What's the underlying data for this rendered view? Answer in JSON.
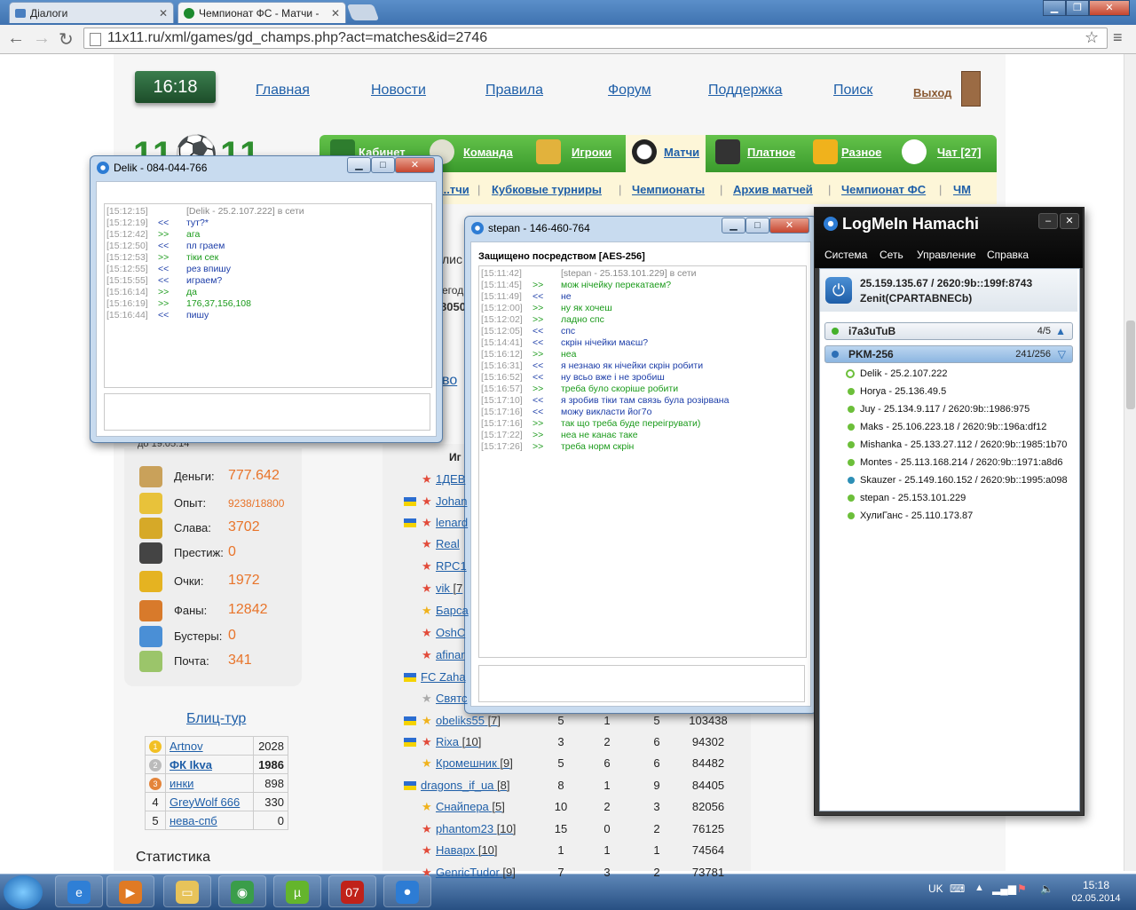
{
  "browser": {
    "tabs": [
      {
        "title": "Діалоги"
      },
      {
        "title": "Чемпионат ФС - Матчи -"
      }
    ],
    "url": "11x11.ru/xml/games/gd_champs.php?act=matches&id=2746"
  },
  "site": {
    "clock": "16:18",
    "top_links": [
      "Главная",
      "Новости",
      "Правила",
      "Форум",
      "Поддержка",
      "Поиск"
    ],
    "exit": "Выход",
    "logo": "11⚽11",
    "main_nav": [
      "Кабинет",
      "Команда",
      "Игроки",
      "Матчи",
      "Платное",
      "Разное",
      "Чат [27]"
    ],
    "sub_nav": [
      "...тчи",
      "Кубковые турниры",
      "Чемпионаты",
      "Архив матчей",
      "Чемпионат ФС",
      "ЧМ"
    ],
    "partial_date": "до 19.05.14",
    "stats": [
      {
        "label": "Деньги:",
        "value": "777.642",
        "icon": "money-bag-icon"
      },
      {
        "label": "Опыт:",
        "value": "9238/18800",
        "icon": "experience-icon"
      },
      {
        "label": "Слава:",
        "value": "3702",
        "icon": "podium-icon"
      },
      {
        "label": "Престиж:",
        "value": "0",
        "icon": "butler-icon"
      },
      {
        "label": "Очки:",
        "value": "1972",
        "icon": "trophy-icon"
      },
      {
        "label": "Фаны:",
        "value": "12842",
        "icon": "fans-icon"
      },
      {
        "label": "Бустеры:",
        "value": "0",
        "icon": "gift-icon"
      },
      {
        "label": "Почта:",
        "value": "341",
        "icon": "mail-icon"
      }
    ],
    "blitz_title": "Блиц-тур",
    "blitz": [
      {
        "rank": "1",
        "name": "Artnov",
        "score": "2028"
      },
      {
        "rank": "2",
        "name": "ФК Ikva",
        "score": "1986"
      },
      {
        "rank": "3",
        "name": "инки",
        "score": "898"
      },
      {
        "rank": "4",
        "name": "GreyWolf 666",
        "score": "330"
      },
      {
        "rank": "5",
        "name": "нева-спб",
        "score": "0"
      }
    ],
    "stats_heading": "Статистика",
    "table_header": "Иг",
    "partial_left_texts": [
      "лис",
      "егод",
      "8050",
      "во"
    ],
    "table_rows": [
      {
        "name": "1ДЕВ",
        "lvl": "",
        "flag": false,
        "star": "red",
        "a": "",
        "b": "",
        "c": "",
        "pts": ""
      },
      {
        "name": "Johan",
        "lvl": "",
        "flag": true,
        "star": "red",
        "a": "",
        "b": "",
        "c": "",
        "pts": ""
      },
      {
        "name": "lenard",
        "lvl": "",
        "flag": true,
        "star": "red",
        "a": "",
        "b": "",
        "c": "",
        "pts": ""
      },
      {
        "name": "Real",
        "lvl": "",
        "flag": false,
        "star": "red",
        "a": "",
        "b": "",
        "c": "",
        "pts": ""
      },
      {
        "name": "RPC1",
        "lvl": "",
        "flag": false,
        "star": "red",
        "a": "",
        "b": "",
        "c": "",
        "pts": ""
      },
      {
        "name": "vik",
        "lvl": "[7",
        "flag": false,
        "star": "red",
        "a": "",
        "b": "",
        "c": "",
        "pts": ""
      },
      {
        "name": "Барса",
        "lvl": "",
        "flag": false,
        "star": "gold",
        "a": "",
        "b": "",
        "c": "",
        "pts": ""
      },
      {
        "name": "OshC",
        "lvl": "",
        "flag": false,
        "star": "red",
        "a": "",
        "b": "",
        "c": "",
        "pts": ""
      },
      {
        "name": "afinar",
        "lvl": "",
        "flag": false,
        "star": "red",
        "a": "",
        "b": "",
        "c": "",
        "pts": ""
      },
      {
        "name": "FC Zaha",
        "lvl": "",
        "flag": true,
        "star": "",
        "a": "",
        "b": "",
        "c": "",
        "pts": ""
      },
      {
        "name": "Святс",
        "lvl": "",
        "flag": false,
        "star": "gray",
        "a": "",
        "b": "",
        "c": "",
        "pts": ""
      },
      {
        "name": "obeliks55",
        "lvl": "[7]",
        "flag": true,
        "star": "gold",
        "a": "5",
        "b": "1",
        "c": "5",
        "pts": "103438"
      },
      {
        "name": "Rixa",
        "lvl": "[10]",
        "flag": true,
        "star": "red",
        "a": "3",
        "b": "2",
        "c": "6",
        "pts": "94302"
      },
      {
        "name": "Кромешник",
        "lvl": "[9]",
        "flag": false,
        "star": "gold",
        "a": "5",
        "b": "6",
        "c": "6",
        "pts": "84482"
      },
      {
        "name": "dragons_if_ua",
        "lvl": "[8]",
        "flag": true,
        "star": "",
        "a": "8",
        "b": "1",
        "c": "9",
        "pts": "84405"
      },
      {
        "name": "Снайпера",
        "lvl": "[5]",
        "flag": false,
        "star": "gold",
        "a": "10",
        "b": "2",
        "c": "3",
        "pts": "82056"
      },
      {
        "name": "phantom23",
        "lvl": "[10]",
        "flag": false,
        "star": "red",
        "a": "15",
        "b": "0",
        "c": "2",
        "pts": "76125"
      },
      {
        "name": "Наварх",
        "lvl": "[10]",
        "flag": false,
        "star": "red",
        "a": "1",
        "b": "1",
        "c": "1",
        "pts": "74564"
      },
      {
        "name": "GenricTudor",
        "lvl": "[9]",
        "flag": false,
        "star": "red",
        "a": "7",
        "b": "3",
        "c": "2",
        "pts": "73781"
      }
    ]
  },
  "chat_delik": {
    "title": "Delik - 084-044-766",
    "lines": [
      {
        "ts": "[15:12:15]",
        "dir": "",
        "text": "[Delik - 25.2.107.222] в сети",
        "kind": "sys"
      },
      {
        "ts": "[15:12:19]",
        "dir": "<<",
        "text": "тут?*",
        "kind": "in"
      },
      {
        "ts": "[15:12:42]",
        "dir": ">>",
        "text": "ага",
        "kind": "out"
      },
      {
        "ts": "[15:12:50]",
        "dir": "<<",
        "text": "пл граем",
        "kind": "in"
      },
      {
        "ts": "[15:12:53]",
        "dir": ">>",
        "text": "тіки сек",
        "kind": "out"
      },
      {
        "ts": "[15:12:55]",
        "dir": "<<",
        "text": "рез впишу",
        "kind": "in"
      },
      {
        "ts": "[15:15:55]",
        "dir": "<<",
        "text": "играем?",
        "kind": "in"
      },
      {
        "ts": "[15:16:14]",
        "dir": ">>",
        "text": "да",
        "kind": "out"
      },
      {
        "ts": "[15:16:19]",
        "dir": ">>",
        "text": "176,37,156,108",
        "kind": "out"
      },
      {
        "ts": "[15:16:44]",
        "dir": "<<",
        "text": "пишу",
        "kind": "in"
      }
    ]
  },
  "chat_stepan": {
    "title": "stepan - 146-460-764",
    "secure": "Защищено посредством [AES-256]",
    "lines": [
      {
        "ts": "[15:11:42]",
        "dir": "",
        "text": "[stepan - 25.153.101.229] в сети",
        "kind": "sys"
      },
      {
        "ts": "[15:11:45]",
        "dir": ">>",
        "text": "мож нічейку перекатаем?",
        "kind": "out"
      },
      {
        "ts": "[15:11:49]",
        "dir": "<<",
        "text": "не",
        "kind": "in"
      },
      {
        "ts": "[15:12:00]",
        "dir": ">>",
        "text": "ну як хочеш",
        "kind": "out"
      },
      {
        "ts": "[15:12:02]",
        "dir": ">>",
        "text": "ладно спс",
        "kind": "out"
      },
      {
        "ts": "[15:12:05]",
        "dir": "<<",
        "text": "спс",
        "kind": "in"
      },
      {
        "ts": "[15:14:41]",
        "dir": "<<",
        "text": "скрін нічейки маєш?",
        "kind": "in"
      },
      {
        "ts": "[15:16:12]",
        "dir": ">>",
        "text": "неа",
        "kind": "out"
      },
      {
        "ts": "[15:16:31]",
        "dir": "<<",
        "text": "я незнаю  як нічейки скрін робити",
        "kind": "in"
      },
      {
        "ts": "[15:16:52]",
        "dir": "<<",
        "text": "ну всьо вже і не зробиш",
        "kind": "in"
      },
      {
        "ts": "[15:16:57]",
        "dir": ">>",
        "text": "треба було скоріше робити",
        "kind": "out"
      },
      {
        "ts": "[15:17:10]",
        "dir": "<<",
        "text": "я зробив тіки там связь була розірвана",
        "kind": "in"
      },
      {
        "ts": "[15:17:16]",
        "dir": "<<",
        "text": "можу викласти йог7о",
        "kind": "in"
      },
      {
        "ts": "[15:17:16]",
        "dir": ">>",
        "text": "так що треба буде переігрувати)",
        "kind": "out"
      },
      {
        "ts": "[15:17:22]",
        "dir": ">>",
        "text": "неа не канає таке",
        "kind": "out"
      },
      {
        "ts": "[15:17:26]",
        "dir": ">>",
        "text": "треба норм скрін",
        "kind": "out"
      }
    ]
  },
  "hamachi": {
    "title": "LogMeIn Hamachi",
    "menu": [
      "Система",
      "Сеть",
      "Управление",
      "Справка"
    ],
    "address": "25.159.135.67 / 2620:9b::199f:8743",
    "client_name": "Zenit(CPARTABNECb)",
    "networks": [
      {
        "name": "i7a3uTuB",
        "count": "4/5",
        "arrow": "▲"
      },
      {
        "name": "PKM-256",
        "count": "241/256",
        "arrow": "▽"
      }
    ],
    "peers": [
      "Delik - 25.2.107.222",
      "Horya - 25.136.49.5",
      "Juy - 25.134.9.117 / 2620:9b::1986:975",
      "Maks - 25.106.223.18 / 2620:9b::196a:df12",
      "Mishanka - 25.133.27.112 / 2620:9b::1985:1b70",
      "Montes - 25.113.168.214 / 2620:9b::1971:a8d6",
      "Skauzer - 25.149.160.152 / 2620:9b::1995:a098",
      "stepan - 25.153.101.229",
      "ХулиГанс - 25.110.173.87"
    ]
  },
  "taskbar": {
    "apps": [
      "ie-icon",
      "media-player-icon",
      "explorer-icon",
      "chrome-icon",
      "utorrent-icon",
      "07-icon",
      "hamachi-icon"
    ],
    "lang": "UK",
    "time": "15:18",
    "date": "02.05.2014"
  }
}
